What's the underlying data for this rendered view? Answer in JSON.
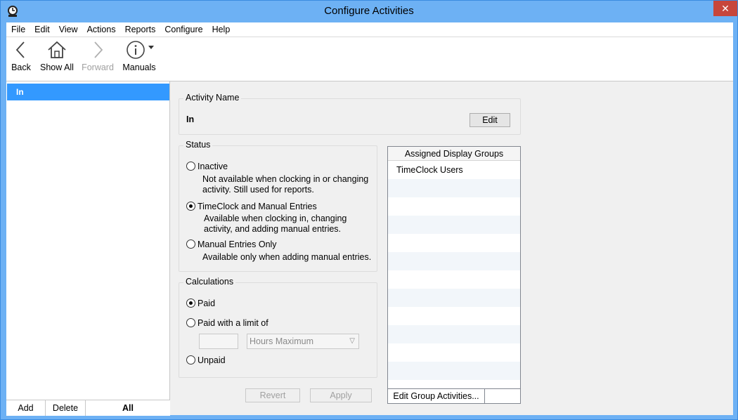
{
  "window": {
    "title": "Configure Activities",
    "close_glyph": "✕"
  },
  "menu": [
    "File",
    "Edit",
    "View",
    "Actions",
    "Reports",
    "Configure",
    "Help"
  ],
  "toolbar": {
    "back": "Back",
    "show_all": "Show All",
    "forward": "Forward",
    "manuals": "Manuals"
  },
  "activity_list": {
    "selected": "In",
    "buttons": {
      "add": "Add",
      "delete": "Delete",
      "all": "All"
    }
  },
  "activity_name": {
    "label": "Activity Name",
    "value": "In",
    "edit_button": "Edit"
  },
  "status": {
    "label": "Status",
    "options": [
      {
        "label": "Inactive",
        "description": "Not available when clocking in or changing activity. Still used for reports.",
        "selected": false
      },
      {
        "label": "TimeClock and Manual Entries",
        "description": "Available when clocking in, changing activity, and adding manual entries.",
        "selected": true
      },
      {
        "label": "Manual Entries Only",
        "description": "Available only when adding manual entries.",
        "selected": false
      }
    ]
  },
  "calculations": {
    "label": "Calculations",
    "paid": "Paid",
    "paid_limit": "Paid with a limit of",
    "limit_value": "",
    "limit_unit": "Hours Maximum",
    "unpaid": "Unpaid",
    "selected": "Paid"
  },
  "actions": {
    "revert": "Revert",
    "apply": "Apply"
  },
  "display_groups": {
    "header": "Assigned Display Groups",
    "items": [
      "TimeClock Users"
    ],
    "edit_button": "Edit Group Activities..."
  },
  "colors": {
    "title_bar": "#6db1f4",
    "selection": "#3399ff",
    "close": "#c7463b"
  }
}
